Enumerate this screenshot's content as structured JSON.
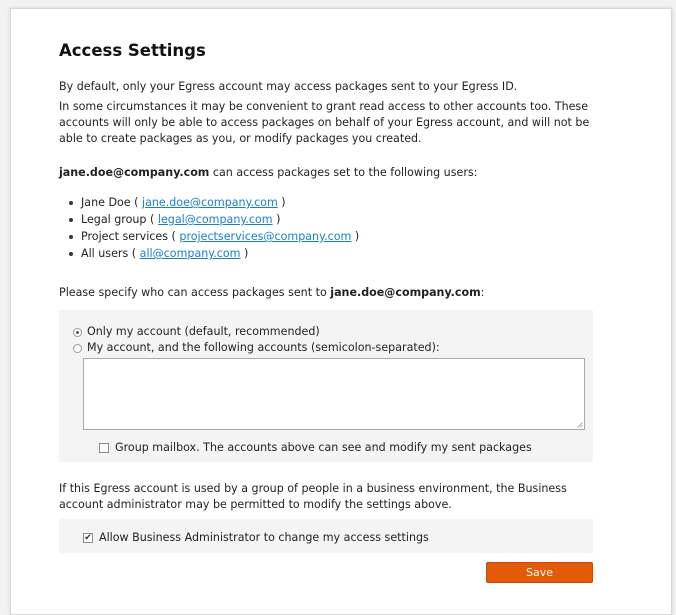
{
  "page": {
    "title": "Access Settings",
    "intro": "By default, only your Egress account may access packages sent to your Egress ID.",
    "explanation": "In some circumstances it may be convenient to grant read access to other accounts too. These accounts will only be able to access packages on behalf of your Egress account, and will not be able to create packages as you, or modify packages you created.",
    "access_owner": "jane.doe@company.com",
    "access_suffix": " can access packages set to the following users:",
    "users": [
      {
        "name": "Jane Doe",
        "email": "jane.doe@company.com"
      },
      {
        "name": "Legal group",
        "email": "legal@company.com"
      },
      {
        "name": "Project services",
        "email": "projectservices@company.com"
      },
      {
        "name": "All users",
        "email": "all@company.com"
      }
    ],
    "specify_prefix": "Please specify who can access packages sent to ",
    "specify_email": "jane.doe@company.com",
    "specify_suffix": ":"
  },
  "options": {
    "only_mine_label": "Only my account (default, recommended)",
    "only_mine_selected": true,
    "following_label": "My account, and the following accounts (semicolon-separated):",
    "following_selected": false,
    "accounts_value": "",
    "group_mailbox_label": "Group mailbox. The accounts above can see and modify my sent packages",
    "group_mailbox_checked": false
  },
  "business": {
    "note": "If this Egress account is used by a group of people in a business environment, the Business account administrator may be permitted to modify the settings above.",
    "allow_admin_label": "Allow Business Administrator to change my access settings",
    "allow_admin_checked": true
  },
  "actions": {
    "save_label": "Save"
  },
  "colors": {
    "accent": "#e35a0a",
    "link": "#1a7fc7"
  }
}
